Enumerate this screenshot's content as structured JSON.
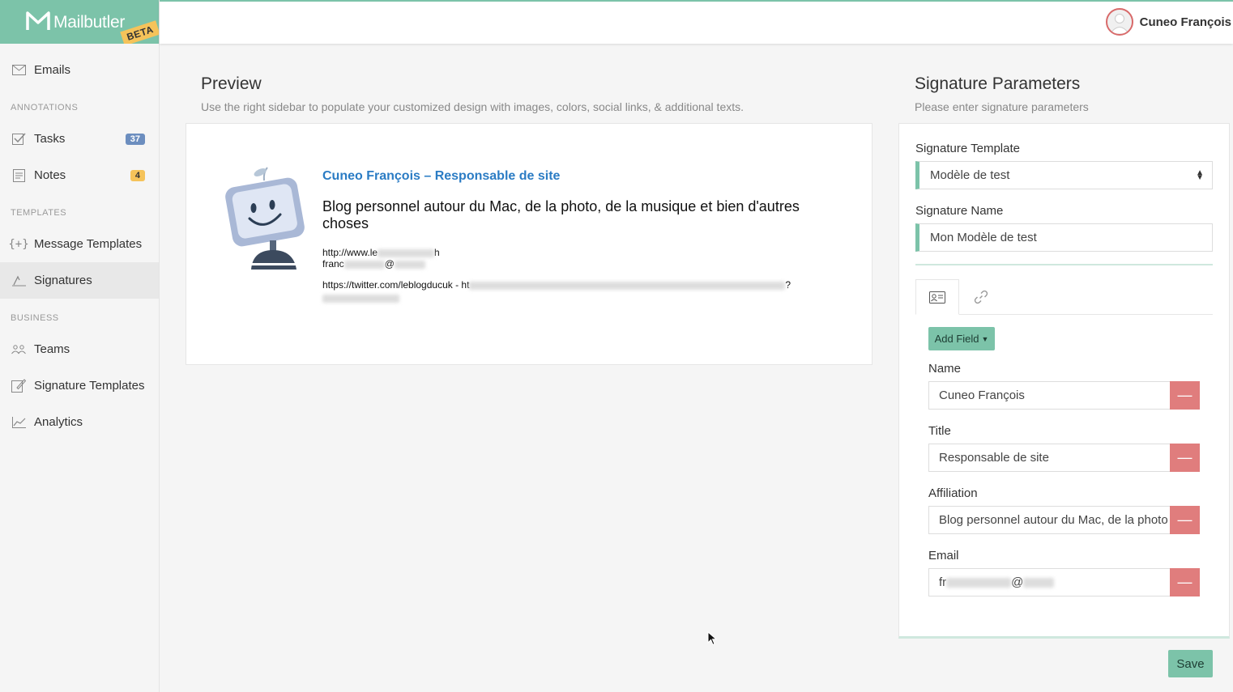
{
  "brand": {
    "name": "Mailbutler",
    "beta": "BETA",
    "accent": "#7cc3a9"
  },
  "user": {
    "name": "Cuneo François"
  },
  "sidebar": {
    "emails": "Emails",
    "sections": {
      "annotations": "ANNOTATIONS",
      "templates": "TEMPLATES",
      "business": "BUSINESS"
    },
    "tasks": {
      "label": "Tasks",
      "count": "37"
    },
    "notes": {
      "label": "Notes",
      "count": "4"
    },
    "message_templates": "Message Templates",
    "signatures": "Signatures",
    "teams": "Teams",
    "signature_templates": "Signature Templates",
    "analytics": "Analytics"
  },
  "preview": {
    "title": "Preview",
    "subtitle": "Use the right sidebar to populate your customized design with images, colors, social links, & additional texts.",
    "sig_name": "Cuneo François – Responsable de site",
    "sig_affiliation": "Blog personnel autour du Mac, de la photo, de la musique et bien d'autres choses",
    "sig_web": "http://www.le",
    "sig_web_end": "h",
    "sig_email": "franc",
    "sig_email_at": "@",
    "sig_links": "https://twitter.com/leblogducuk - ht",
    "sig_links_end": "?"
  },
  "params": {
    "title": "Signature Parameters",
    "subtitle": "Please enter signature parameters",
    "template_label": "Signature Template",
    "template_value": "Modèle de test",
    "name_label": "Signature Name",
    "name_value": "Mon Modèle de test",
    "add_field": "Add Field",
    "fields": {
      "name": {
        "label": "Name",
        "value": "Cuneo François"
      },
      "title": {
        "label": "Title",
        "value": "Responsable de site"
      },
      "affiliation": {
        "label": "Affiliation",
        "value": "Blog personnel autour du Mac, de la photo"
      },
      "email": {
        "label": "Email",
        "value_start": "fr",
        "value_at": "@"
      }
    },
    "remove_symbol": "—"
  },
  "save": "Save",
  "icons": [
    "envelope-icon",
    "checkbox-icon",
    "note-icon",
    "braces-plus-icon",
    "signature-pen-icon",
    "team-icon",
    "template-pen-icon",
    "chart-line-icon",
    "contact-card-icon",
    "link-icon",
    "avatar-icon",
    "cursor-icon"
  ]
}
